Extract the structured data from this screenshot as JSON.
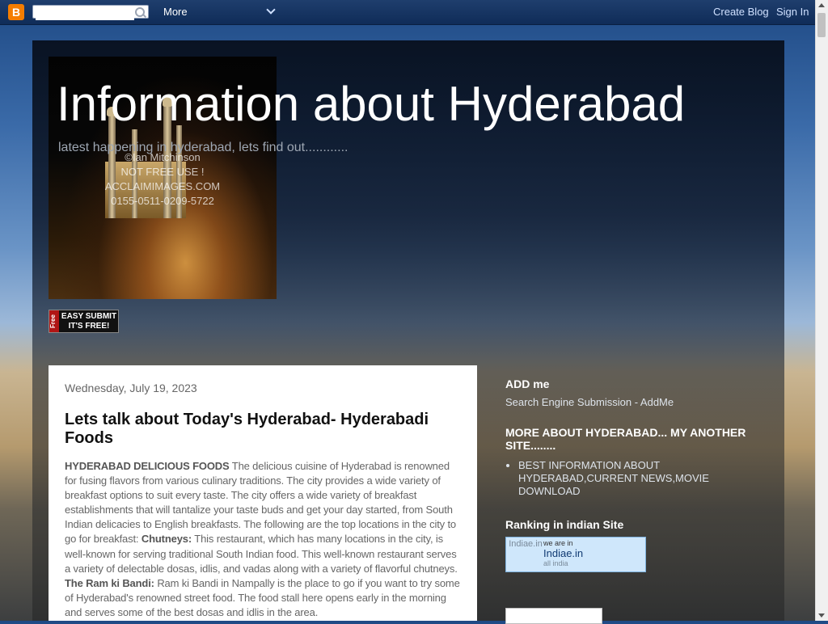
{
  "navbar": {
    "logo_glyph": "B",
    "search_placeholder": "",
    "more_label": "More",
    "create_blog_label": "Create Blog",
    "sign_in_label": "Sign In"
  },
  "header": {
    "title": "Information about Hyderabad",
    "description": "latest happening in hyderabad, lets find out............",
    "image_watermark": [
      "©Ian Mitchinson",
      "NOT FREE USE !",
      "ACCLAIMIMAGES.COM",
      "0155-0511-0209-5722"
    ]
  },
  "easy_submit": {
    "free_label": "Free",
    "line1": "EASY SUBMIT",
    "line2": "IT'S FREE!"
  },
  "post": {
    "date": "Wednesday, July 19, 2023",
    "title": "Lets talk about Today's Hyderabad- Hyderabadi Foods",
    "lead_heading": "HYDERABAD DELICIOUS FOODS",
    "intro": " The delicious cuisine of Hyderabad is renowned for fusing flavors from various culinary traditions. The city provides a wide variety of breakfast options to suit every taste. The city offers a wide variety of breakfast establishments that will tantalize your taste buds and get your day started, from South Indian delicacies to English breakfasts. The following are the top locations in the city to go for breakfast: ",
    "item1_name": "Chutneys:",
    "item1_text": " This restaurant, which has many locations in the city, is well-known for serving traditional South Indian food. This well-known restaurant serves a variety of delectable dosas, idlis, and vadas along with a variety of flavorful chutneys. ",
    "item2_name": "The Ram ki Bandi:",
    "item2_text": " Ram ki Bandi in Nampally is the place to go if you want to try some of Hyderabad's renowned street food. The food stall here opens early in the morning and serves some of the best dosas and idlis in the area."
  },
  "sidebar": {
    "add_me_heading": "ADD me",
    "add_me_text": "Search Engine Submission - AddMe",
    "more_about_heading": "MORE ABOUT HYDERABAD... MY ANOTHER SITE........",
    "more_about_links": [
      "BEST INFORMATION ABOUT HYDERABAD,CURRENT NEWS,MOVIE DOWNLOAD"
    ],
    "ranking_heading": "Ranking in indian Site",
    "ranking_widget": {
      "logo_alt": "Indiae.in",
      "line1": "we are in",
      "brand": "Indiae.in",
      "sub": "all india"
    }
  },
  "colors": {
    "navbar": "#1f3e6d",
    "blogger_orange": "#f57d00",
    "post_background": "#ffffff",
    "title_white": "#ffffff"
  }
}
